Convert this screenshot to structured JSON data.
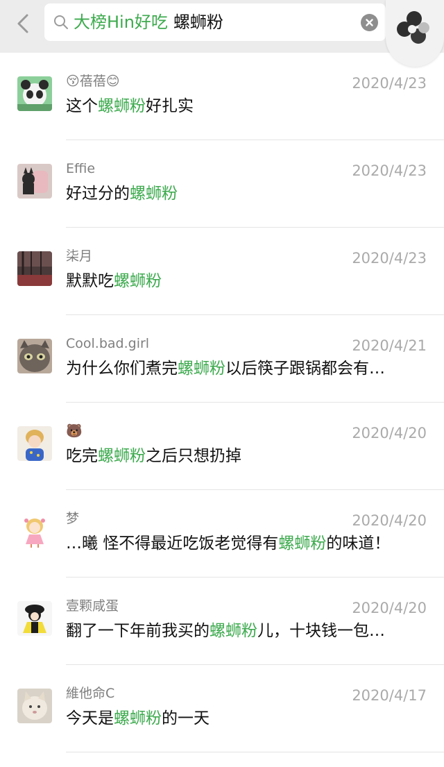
{
  "search": {
    "tag": "大榜Hin好吃",
    "keyword": "螺蛳粉"
  },
  "colors": {
    "highlight": "#3daa4e",
    "meta": "#aaaaaa",
    "nickname": "#7f7f7f"
  },
  "results": [
    {
      "nickname": "😚蓓蓓😊",
      "date": "2020/4/23",
      "before": "这个",
      "hl": "螺蛳粉",
      "after": "好扎实"
    },
    {
      "nickname": "Effie",
      "date": "2020/4/23",
      "before": "好过分的",
      "hl": "螺蛳粉",
      "after": ""
    },
    {
      "nickname": "柒月",
      "date": "2020/4/23",
      "before": "默默吃",
      "hl": "螺蛳粉",
      "after": ""
    },
    {
      "nickname": "Cool.bad.girl",
      "date": "2020/4/21",
      "before": "为什么你们煮完",
      "hl": "螺蛳粉",
      "after": "以后筷子跟锅都会有…"
    },
    {
      "nickname": "🐻",
      "date": "2020/4/20",
      "before": "吃完",
      "hl": "螺蛳粉",
      "after": "之后只想扔掉"
    },
    {
      "nickname": "梦",
      "date": "2020/4/20",
      "before": "…曦 怪不得最近吃饭老觉得有",
      "hl": "螺蛳粉",
      "after": "的味道！"
    },
    {
      "nickname": "壹颗咸蛋",
      "date": "2020/4/20",
      "before": "翻了一下年前我买的",
      "hl": "螺蛳粉",
      "after": "儿，十块钱一包…"
    },
    {
      "nickname": "維他命C",
      "date": "2020/4/17",
      "before": "今天是",
      "hl": "螺蛳粉",
      "after": "的一天"
    }
  ]
}
